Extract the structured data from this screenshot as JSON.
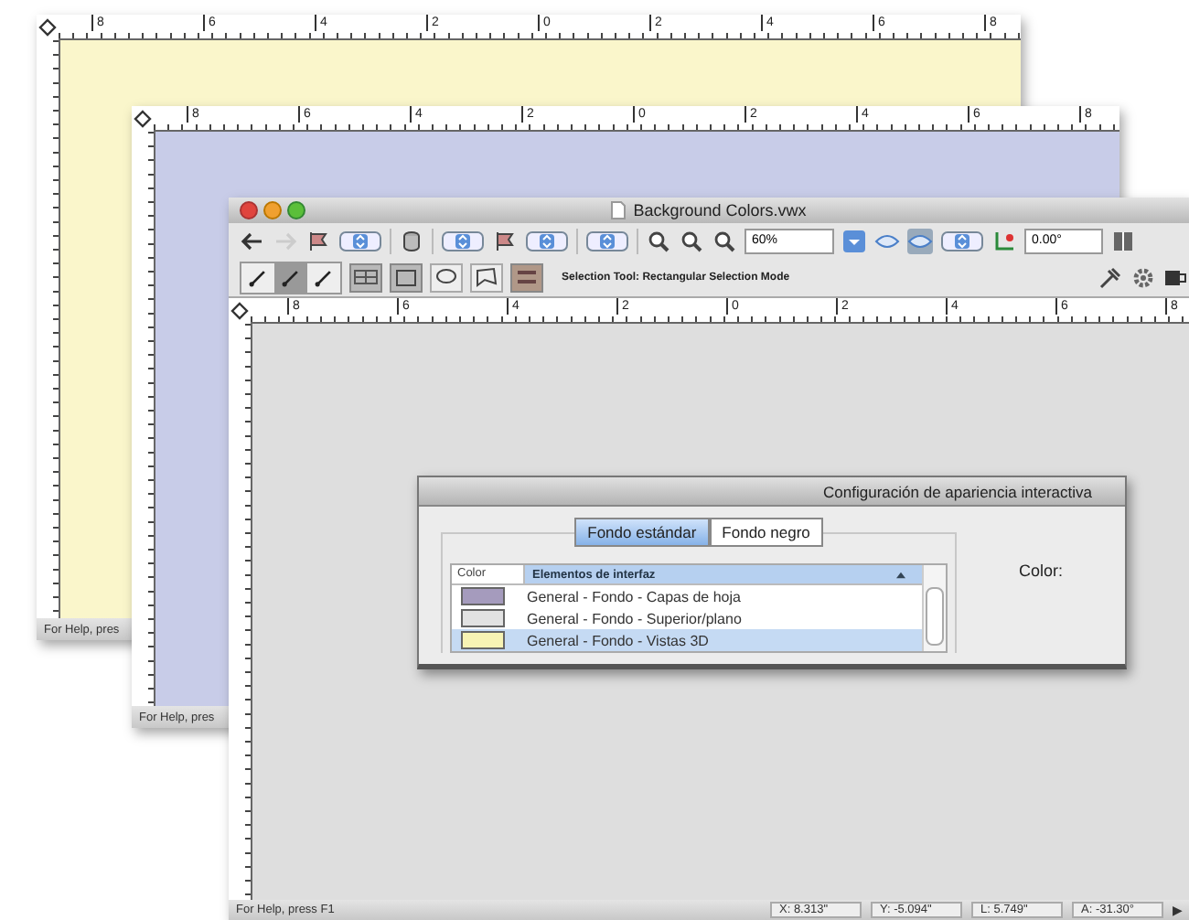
{
  "windows": [
    {
      "color": "#faf6cb",
      "ruler_labels": [
        "8",
        "6",
        "4",
        "2",
        "0",
        "2",
        "4",
        "6",
        "8"
      ],
      "status": "For Help, pres"
    },
    {
      "color": "#c8cce8",
      "ruler_labels": [
        "8",
        "6",
        "4",
        "2",
        "0",
        "2",
        "4",
        "6",
        "8"
      ],
      "status": "For Help, pres"
    }
  ],
  "main_window": {
    "title": "Background Colors.vwx",
    "zoom": "60%",
    "angle": "0.00°",
    "mode_buttons": [
      {
        "selected": false
      },
      {
        "selected": true
      },
      {
        "selected": false
      }
    ],
    "mode_text": "Selection Tool: Rectangular Selection Mode",
    "ruler_labels": [
      "8",
      "6",
      "4",
      "2",
      "0",
      "2",
      "4",
      "6",
      "8"
    ],
    "status": "For Help, press F1",
    "readouts": [
      "X: 8.313\"",
      "Y: -5.094\"",
      "L: 5.749\"",
      "A: -31.30°"
    ],
    "scroll_arrow": "▶"
  },
  "dialog": {
    "title": "Configuración de apariencia interactiva",
    "tabs": [
      {
        "label": "Fondo estándar",
        "selected": true
      },
      {
        "label": "Fondo negro",
        "selected": false
      }
    ],
    "color_label": "Color:",
    "columns": [
      "Color",
      "Elementos de interfaz"
    ],
    "rows": [
      {
        "color": "#a59bbd",
        "label": "General - Fondo - Capas de hoja",
        "selected": false
      },
      {
        "color": "#e2e2e2",
        "label": "General - Fondo - Superior/plano",
        "selected": false
      },
      {
        "color": "#f7f3b4",
        "label": "General - Fondo - Vistas 3D",
        "selected": true
      }
    ]
  }
}
